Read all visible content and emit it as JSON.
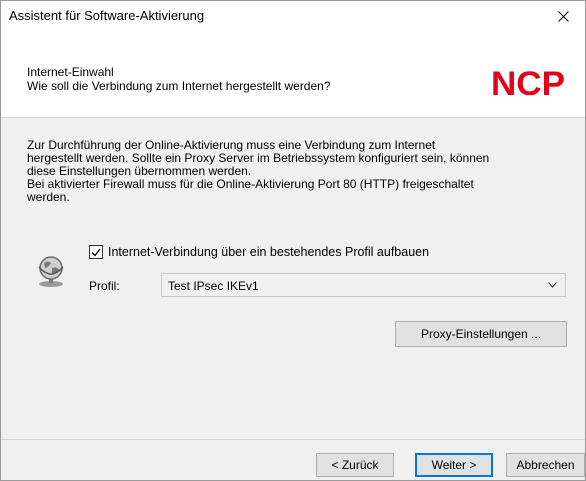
{
  "window": {
    "title": "Assistent für Software-Aktivierung",
    "close_symbol": "✕"
  },
  "header": {
    "title": "Internet-Einwahl",
    "subtitle": "Wie soll die Verbindung zum Internet hergestellt werden?",
    "logo_text": "NCP"
  },
  "body": {
    "paragraph_lines": [
      "Zur Durchführung der Online-Aktivierung muss eine Verbindung zum Internet",
      "hergestellt werden. Sollte ein Proxy Server im Betriebssystem konfiguriert sein, können",
      "diese Einstellungen übernommen werden.",
      "Bei aktivierter Firewall muss für die Online-Aktivierung Port 80 (HTTP) freigeschaltet",
      "werden."
    ]
  },
  "connection": {
    "checkbox_label": "Internet-Verbindung über ein bestehendes Profil aufbauen",
    "checkbox_checked": true,
    "profil_label": "Profil:",
    "profil_value": "Test IPsec IKEv1",
    "proxy_button": "Proxy-Einstellungen ..."
  },
  "footer": {
    "back": "< Zurück",
    "next": "Weiter >",
    "cancel": "Abbrechen"
  },
  "colors": {
    "logo_red": "#e2001a",
    "accent": "#0078d7"
  },
  "icons": {
    "globe": "globe-network-icon",
    "close": "close-icon",
    "chevron": "chevron-down-icon",
    "check": "checkmark-icon"
  }
}
